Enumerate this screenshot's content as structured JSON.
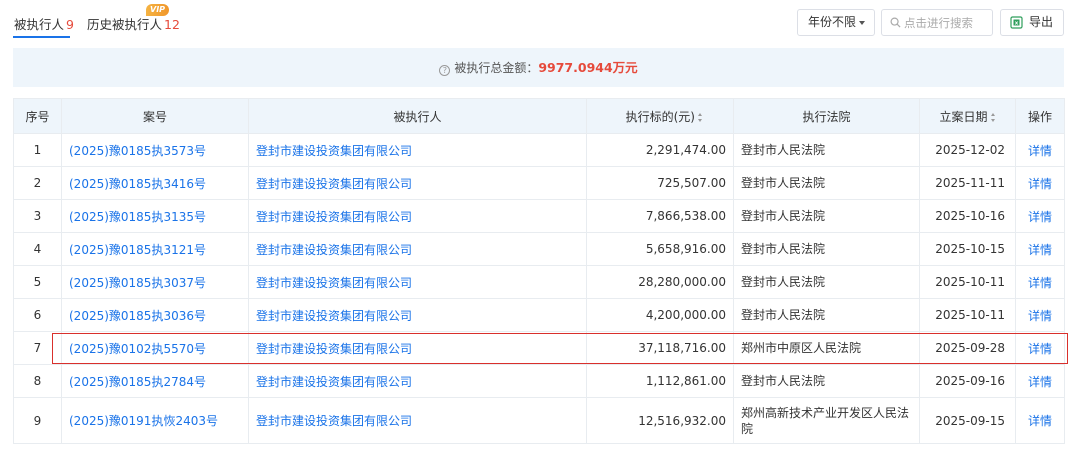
{
  "tabs": {
    "active": {
      "label": "被执行人",
      "count": "9"
    },
    "history": {
      "label": "历史被执行人",
      "count": "12",
      "badge": "VIP"
    }
  },
  "toolbar": {
    "year_filter": "年份不限",
    "search_placeholder": "点击进行搜索",
    "export_label": "导出"
  },
  "summary": {
    "label": "被执行总金额：",
    "amount": "9977.0944万元"
  },
  "table": {
    "headers": {
      "index": "序号",
      "case_no": "案号",
      "party": "被执行人",
      "amount": "执行标的(元)",
      "court": "执行法院",
      "date": "立案日期",
      "op": "操作"
    },
    "rows": [
      {
        "index": "1",
        "case_no": "(2025)豫0185执3573号",
        "party": "登封市建设投资集团有限公司",
        "amount": "2,291,474.00",
        "court": "登封市人民法院",
        "date": "2025-12-02",
        "op": "详情"
      },
      {
        "index": "2",
        "case_no": "(2025)豫0185执3416号",
        "party": "登封市建设投资集团有限公司",
        "amount": "725,507.00",
        "court": "登封市人民法院",
        "date": "2025-11-11",
        "op": "详情"
      },
      {
        "index": "3",
        "case_no": "(2025)豫0185执3135号",
        "party": "登封市建设投资集团有限公司",
        "amount": "7,866,538.00",
        "court": "登封市人民法院",
        "date": "2025-10-16",
        "op": "详情"
      },
      {
        "index": "4",
        "case_no": "(2025)豫0185执3121号",
        "party": "登封市建设投资集团有限公司",
        "amount": "5,658,916.00",
        "court": "登封市人民法院",
        "date": "2025-10-15",
        "op": "详情"
      },
      {
        "index": "5",
        "case_no": "(2025)豫0185执3037号",
        "party": "登封市建设投资集团有限公司",
        "amount": "28,280,000.00",
        "court": "登封市人民法院",
        "date": "2025-10-11",
        "op": "详情"
      },
      {
        "index": "6",
        "case_no": "(2025)豫0185执3036号",
        "party": "登封市建设投资集团有限公司",
        "amount": "4,200,000.00",
        "court": "登封市人民法院",
        "date": "2025-10-11",
        "op": "详情"
      },
      {
        "index": "7",
        "case_no": "(2025)豫0102执5570号",
        "party": "登封市建设投资集团有限公司",
        "amount": "37,118,716.00",
        "court": "郑州市中原区人民法院",
        "date": "2025-09-28",
        "op": "详情"
      },
      {
        "index": "8",
        "case_no": "(2025)豫0185执2784号",
        "party": "登封市建设投资集团有限公司",
        "amount": "1,112,861.00",
        "court": "登封市人民法院",
        "date": "2025-09-16",
        "op": "详情"
      },
      {
        "index": "9",
        "case_no": "(2025)豫0191执恢2403号",
        "party": "登封市建设投资集团有限公司",
        "amount": "12,516,932.00",
        "court": "郑州高新技术产业开发区人民法院",
        "date": "2025-09-15",
        "op": "详情"
      }
    ]
  },
  "colors": {
    "link": "#1a73e8",
    "accent_red": "#e64a3b",
    "highlight_border": "#d9302c",
    "header_bg": "#eef5fb"
  }
}
